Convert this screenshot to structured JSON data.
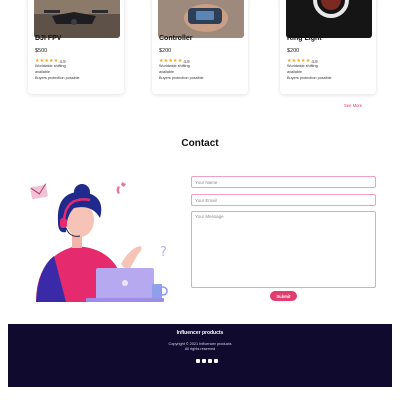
{
  "products": [
    {
      "name": "DJI FPV",
      "price": "$500",
      "stars": "★★★★★",
      "rating": "4.9",
      "shipping": "Worldwide shifting",
      "availability": "available",
      "protection": "Buyers protection possible"
    },
    {
      "name": "Controller",
      "price": "$200",
      "stars": "★★★★★",
      "rating": "4.9",
      "shipping": "Worldwide shifting",
      "availability": "available",
      "protection": "Buyers protection possible"
    },
    {
      "name": "Ring Light",
      "price": "$200",
      "stars": "★★★★★",
      "rating": "4.9",
      "shipping": "Worldwide shifting",
      "availability": "available",
      "protection": "Buyers protection possible"
    }
  ],
  "see_more": "See More",
  "contact": {
    "title": "Contact",
    "name_placeholder": "Your Name",
    "email_placeholder": "Your Email",
    "message_placeholder": "Your Message",
    "submit": "Submit"
  },
  "footer": {
    "brand": "Influencer products",
    "copyright": "Copyright © 2021 Influencer products",
    "rights": "All rights reserved",
    "socials": [
      "facebook-icon",
      "instagram-icon",
      "youtube-icon",
      "twitter-icon"
    ]
  },
  "colors": {
    "accent": "#e23d6f",
    "footer_bg": "#0f0a2e",
    "star": "#f7a21b",
    "field_border": "#f0a0c0"
  }
}
